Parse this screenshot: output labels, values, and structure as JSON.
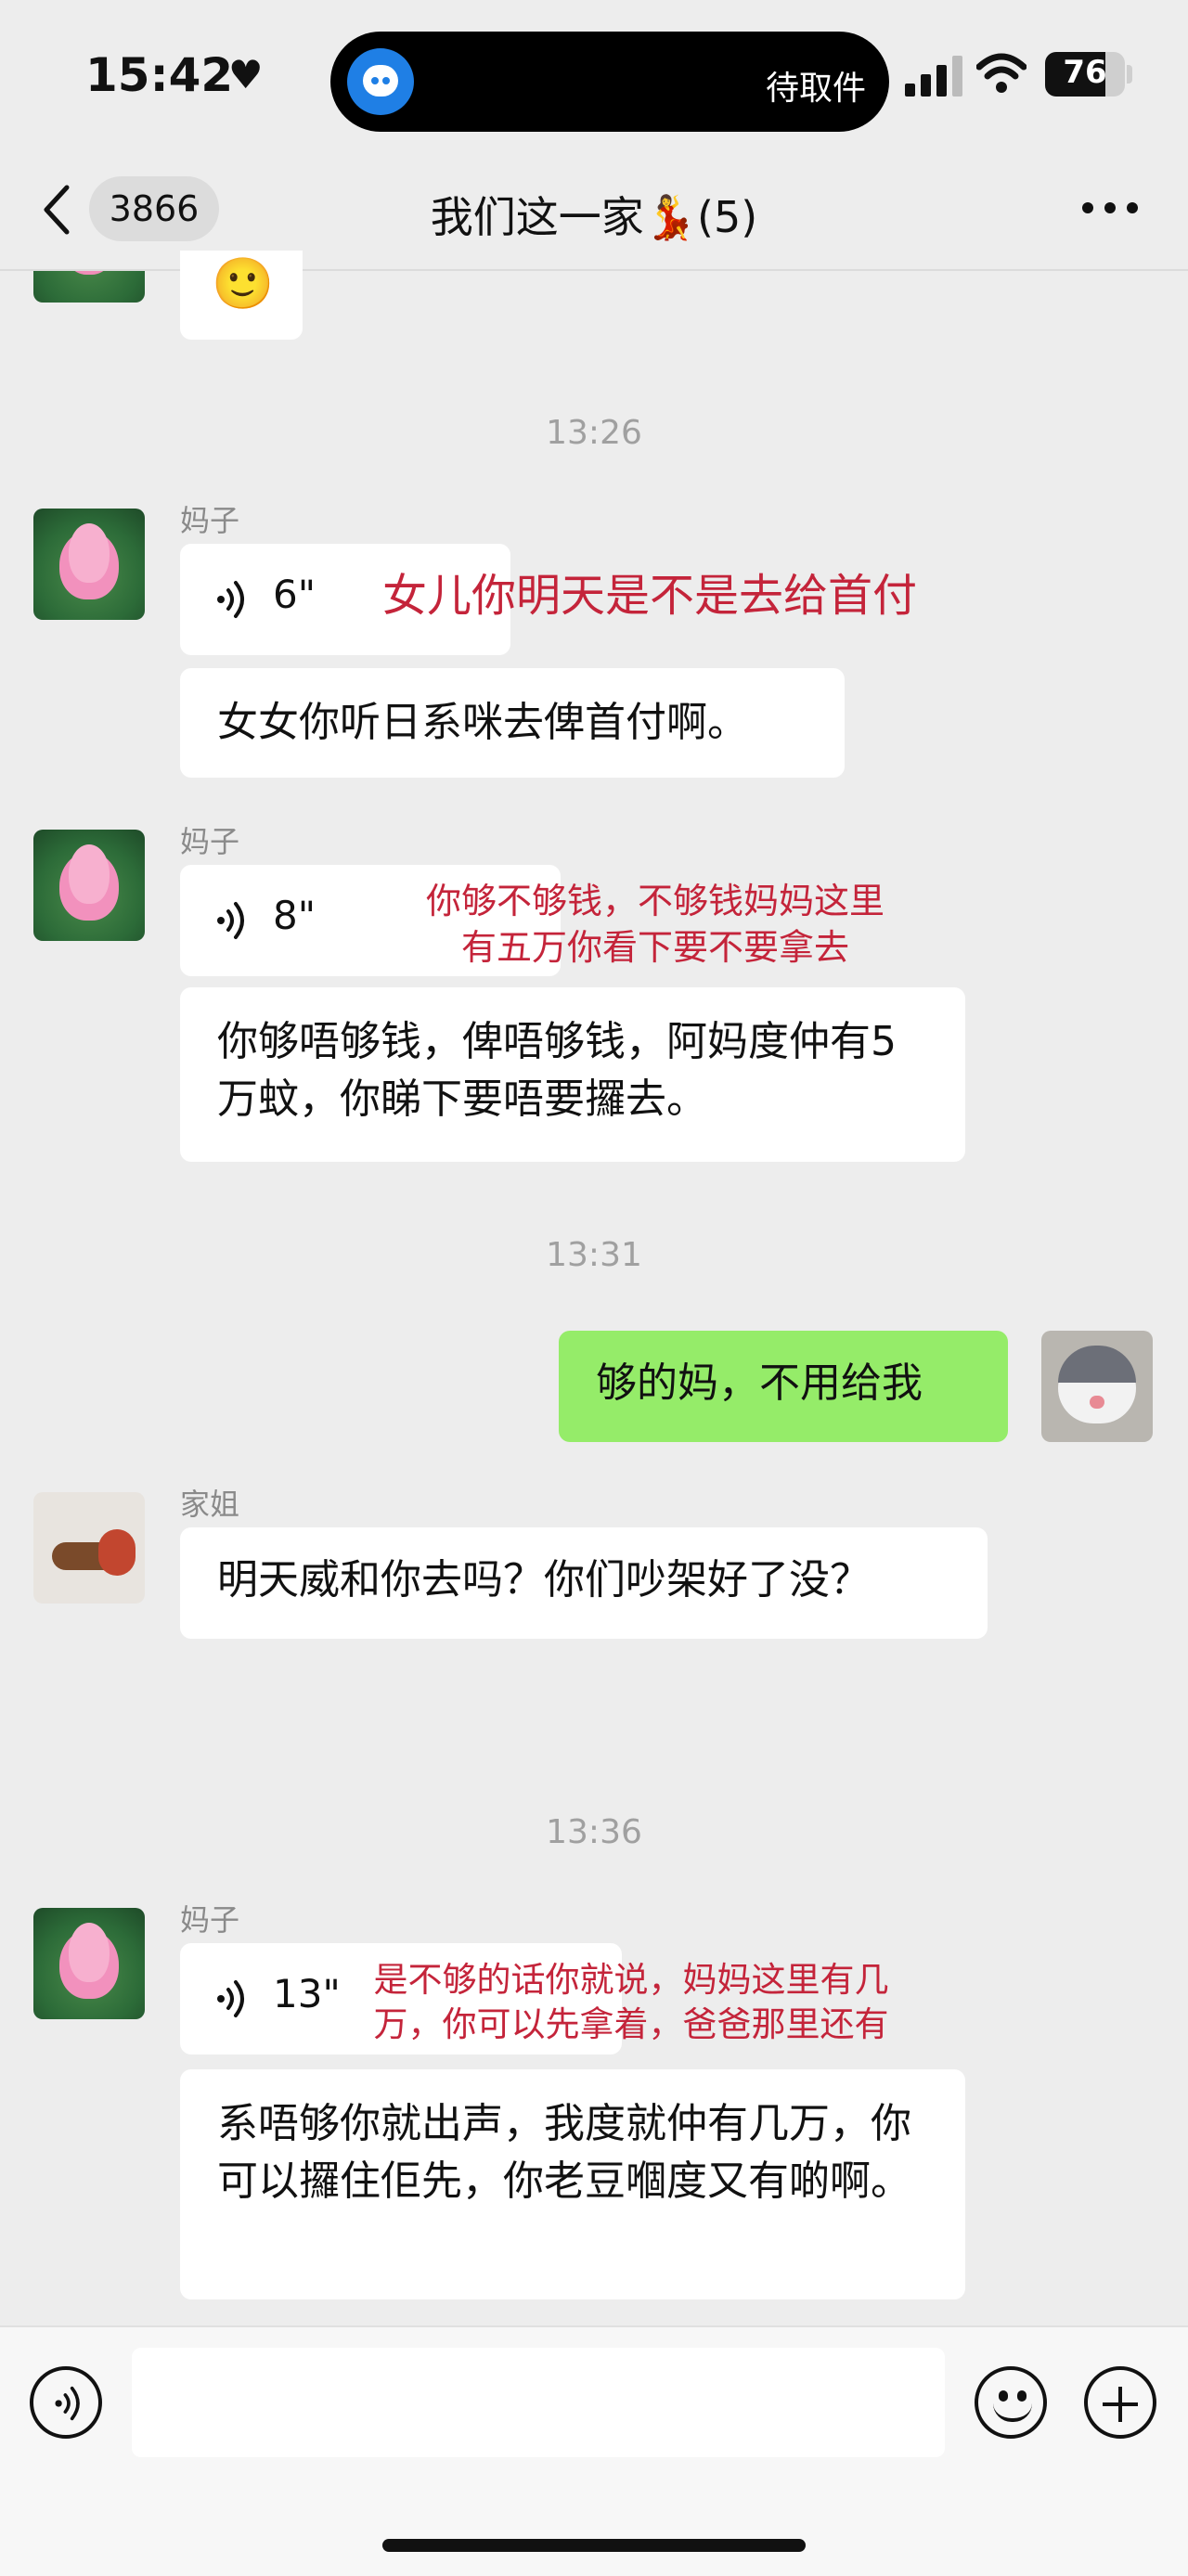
{
  "status_bar": {
    "time": "15:42",
    "heart_icon": "heart-icon",
    "island_text": "待取件",
    "battery": "76"
  },
  "nav": {
    "unread_count": "3866",
    "title": "我们这一家💃(5)",
    "more_icon": "more-icon"
  },
  "messages": [
    {
      "type": "sticker",
      "sender": "",
      "emoji": "🙂"
    },
    {
      "type": "timestamp",
      "text": "13:26"
    },
    {
      "type": "voice",
      "sender": "妈子",
      "duration": "6\"",
      "note": "女儿你明天是不是去给首付",
      "transcript": "女女你听日系咪去俾首付啊。"
    },
    {
      "type": "voice",
      "sender": "妈子",
      "duration": "8\"",
      "note": "你够不够钱，不够钱妈妈这里有五万你看下要不要拿去",
      "transcript": "你够唔够钱，俾唔够钱，阿妈度仲有5万蚊，你睇下要唔要攞去。"
    },
    {
      "type": "timestamp",
      "text": "13:31"
    },
    {
      "type": "text",
      "sender": "me",
      "text": "够的妈，不用给我"
    },
    {
      "type": "text",
      "sender": "家姐",
      "text": "明天威和你去吗？你们吵架好了没？"
    },
    {
      "type": "timestamp",
      "text": "13:36"
    },
    {
      "type": "voice",
      "sender": "妈子",
      "duration": "13\"",
      "note": "是不够的话你就说，妈妈这里有几万，你可以先拿着，爸爸那里还有",
      "transcript": "系唔够你就出声，我度就仲有几万，你可以攞住佢先，你老豆嗰度又有啲啊。"
    }
  ],
  "input_bar": {
    "placeholder": "",
    "voice_icon": "voice-mode-icon",
    "emoji_icon": "emoji-icon",
    "plus_icon": "plus-icon"
  }
}
